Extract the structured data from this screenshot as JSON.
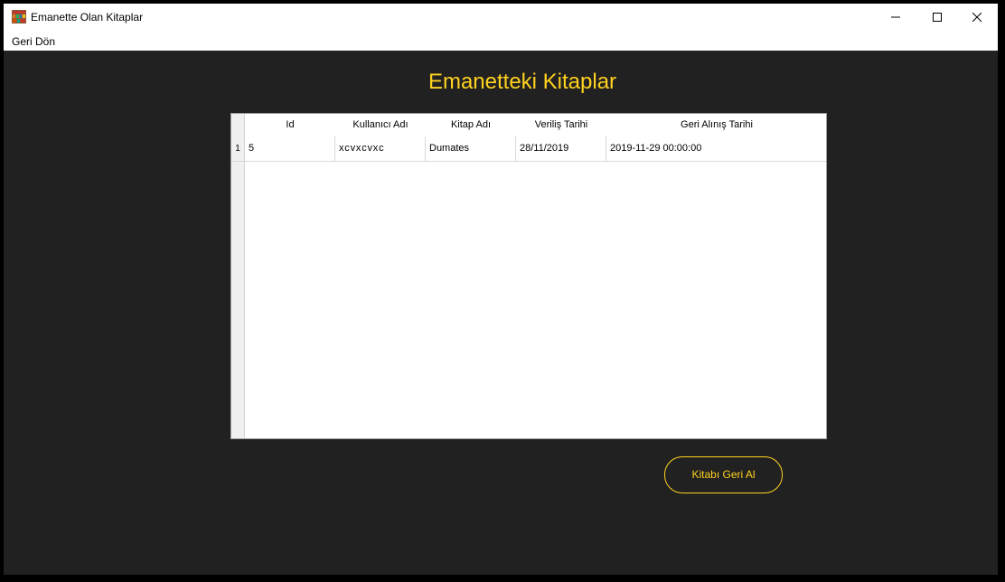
{
  "window": {
    "title": "Emanette Olan Kitaplar",
    "icon": "books-icon"
  },
  "menu": {
    "back_label": "Geri Dön"
  },
  "main": {
    "heading": "Emanetteki Kitaplar",
    "table": {
      "columns": [
        "Id",
        "Kullanıcı Adı",
        "Kitap Adı",
        "Veriliş Tarihi",
        "Geri Alınış Tarihi"
      ],
      "rows": [
        {
          "row_number": "1",
          "cells": [
            "5",
            "xcvxcvxc",
            "Dumates",
            "28/11/2019",
            "2019-11-29 00:00:00"
          ]
        }
      ]
    },
    "return_button_label": "Kitabı Geri Al"
  },
  "colors": {
    "accent": "#ffd21f",
    "background": "#212121",
    "titlebar": "#ffffff"
  }
}
